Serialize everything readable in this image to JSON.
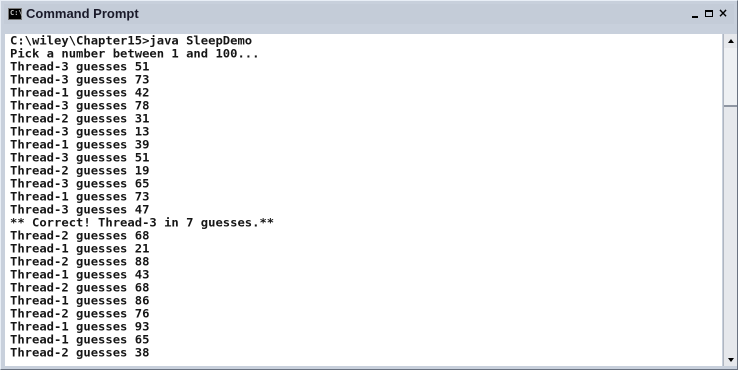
{
  "window": {
    "title": "Command Prompt",
    "icon": "console-icon",
    "icon_glyph": "C:\\",
    "buttons": {
      "minimize": "minimize",
      "maximize": "maximize",
      "close_label": "×"
    }
  },
  "console": {
    "lines": [
      "C:\\wiley\\Chapter15>java SleepDemo",
      "Pick a number between 1 and 100...",
      "Thread-3 guesses 51",
      "Thread-3 guesses 73",
      "Thread-1 guesses 42",
      "Thread-3 guesses 78",
      "Thread-2 guesses 31",
      "Thread-3 guesses 13",
      "Thread-1 guesses 39",
      "Thread-3 guesses 51",
      "Thread-2 guesses 19",
      "Thread-3 guesses 65",
      "Thread-1 guesses 73",
      "Thread-3 guesses 47",
      "** Correct! Thread-3 in 7 guesses.**",
      "Thread-2 guesses 68",
      "Thread-1 guesses 21",
      "Thread-2 guesses 88",
      "Thread-1 guesses 43",
      "Thread-2 guesses 68",
      "Thread-1 guesses 86",
      "Thread-2 guesses 76",
      "Thread-1 guesses 93",
      "Thread-1 guesses 65",
      "Thread-2 guesses 38"
    ]
  },
  "colors": {
    "console_background": "#ffffff",
    "console_text": "#161616",
    "chrome": "#c4ccd8"
  }
}
